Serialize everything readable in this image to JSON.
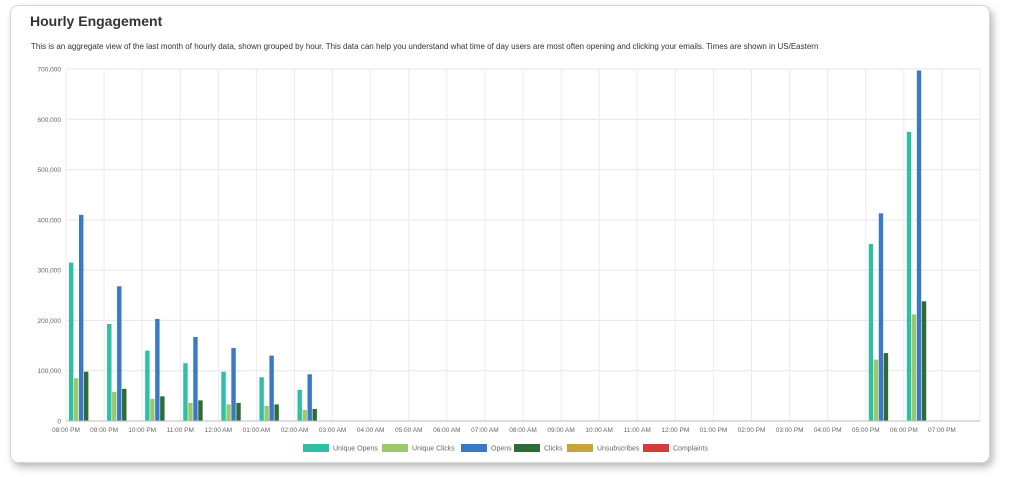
{
  "header": {
    "title": "Hourly Engagement",
    "description": "This is an aggregate view of the last month of hourly data, shown grouped by hour. This data can help you understand what time of day users are most often opening and clicking your emails. Times are shown in  US/Eastern"
  },
  "chart_data": {
    "type": "bar",
    "title": "Hourly Engagement",
    "xlabel": "",
    "ylabel": "",
    "ylim": [
      0,
      700000
    ],
    "yticks": [
      0,
      100000,
      200000,
      300000,
      400000,
      500000,
      600000,
      700000
    ],
    "ytick_labels": [
      "0",
      "100,000",
      "200,000",
      "300,000",
      "400,000",
      "500,000",
      "600,000",
      "700,000"
    ],
    "grid": true,
    "legend_position": "bottom",
    "categories": [
      "08:00 PM",
      "09:00 PM",
      "10:00 PM",
      "11:00 PM",
      "12:00 AM",
      "01:00 AM",
      "02:00 AM",
      "03:00 AM",
      "04:00 AM",
      "05:00 AM",
      "06:00 AM",
      "07:00 AM",
      "08:00 AM",
      "09:00 AM",
      "10:00 AM",
      "11:00 AM",
      "12:00 PM",
      "01:00 PM",
      "02:00 PM",
      "03:00 PM",
      "04:00 PM",
      "05:00 PM",
      "06:00 PM",
      "07:00 PM"
    ],
    "series": [
      {
        "name": "Unique Opens",
        "color": "#2ebfa5",
        "values": [
          315000,
          193000,
          140000,
          115000,
          98000,
          87000,
          62000,
          0,
          0,
          0,
          0,
          0,
          0,
          0,
          0,
          0,
          0,
          0,
          0,
          0,
          0,
          352000,
          575000,
          0
        ]
      },
      {
        "name": "Unique Clicks",
        "color": "#9dc86a",
        "values": [
          85000,
          58000,
          44000,
          36000,
          33000,
          30000,
          22000,
          0,
          0,
          0,
          0,
          0,
          0,
          0,
          0,
          0,
          0,
          0,
          0,
          0,
          0,
          122000,
          212000,
          0
        ]
      },
      {
        "name": "Opens",
        "color": "#3b78c6",
        "values": [
          410000,
          268000,
          203000,
          167000,
          145000,
          130000,
          93000,
          0,
          0,
          0,
          0,
          0,
          0,
          0,
          0,
          0,
          0,
          0,
          0,
          0,
          0,
          413000,
          697000,
          0
        ]
      },
      {
        "name": "Clicks",
        "color": "#2f6b36",
        "values": [
          98000,
          64000,
          49000,
          41000,
          36000,
          33000,
          24000,
          0,
          0,
          0,
          0,
          0,
          0,
          0,
          0,
          0,
          0,
          0,
          0,
          0,
          0,
          135000,
          238000,
          0
        ]
      },
      {
        "name": "Unsubscribes",
        "color": "#c9a43a",
        "values": [
          0,
          0,
          0,
          0,
          0,
          0,
          0,
          0,
          0,
          0,
          0,
          0,
          0,
          0,
          0,
          0,
          0,
          0,
          0,
          0,
          0,
          0,
          0,
          0
        ]
      },
      {
        "name": "Complaints",
        "color": "#d43b3b",
        "values": [
          0,
          0,
          0,
          0,
          0,
          0,
          0,
          0,
          0,
          0,
          0,
          0,
          0,
          0,
          0,
          0,
          0,
          0,
          0,
          0,
          0,
          0,
          0,
          0
        ]
      }
    ]
  }
}
